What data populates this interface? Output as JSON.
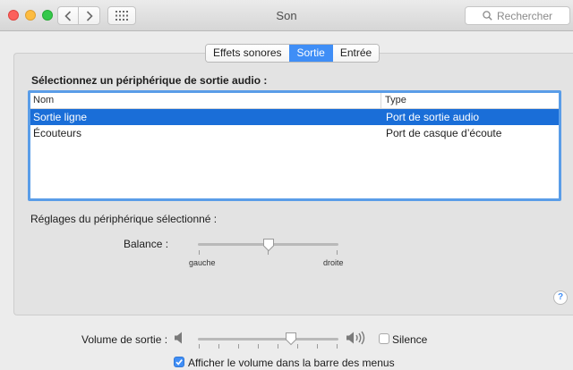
{
  "window": {
    "title": "Son",
    "search_placeholder": "Rechercher",
    "back_icon": "chevron-left-icon",
    "forward_icon": "chevron-right-icon",
    "grid_icon": "grid-icon"
  },
  "tabs": [
    {
      "label": "Effets sonores",
      "active": false
    },
    {
      "label": "Sortie",
      "active": true
    },
    {
      "label": "Entrée",
      "active": false
    }
  ],
  "output": {
    "title": "Sélectionnez un périphérique de sortie audio :",
    "columns": {
      "name": "Nom",
      "type": "Type"
    },
    "rows": [
      {
        "name": "Sortie ligne",
        "type": "Port de sortie audio",
        "selected": true
      },
      {
        "name": "Écouteurs",
        "type": "Port de casque d’écoute",
        "selected": false
      }
    ],
    "selection_color": "#1a6ed8"
  },
  "settings": {
    "label": "Réglages du périphérique sélectionné :",
    "balance_label": "Balance :",
    "balance_left": "gauche",
    "balance_right": "droite",
    "balance_value": 0.5
  },
  "volume": {
    "label": "Volume de sortie :",
    "value": 0.66,
    "mute_label": "Silence",
    "mute_checked": false,
    "menubar_label": "Afficher le volume dans la barre des menus",
    "menubar_checked": true
  },
  "accent_color": "#3f8ef6"
}
